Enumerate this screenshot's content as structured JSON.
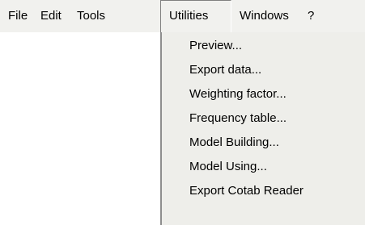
{
  "menubar": {
    "items": [
      {
        "label": "File"
      },
      {
        "label": "Edit"
      },
      {
        "label": "Tools"
      },
      {
        "label": "Utilities"
      },
      {
        "label": "Windows"
      },
      {
        "label": "?"
      }
    ]
  },
  "utilities_menu": {
    "items": [
      {
        "label": "Preview..."
      },
      {
        "label": "Export data..."
      },
      {
        "label": "Weighting factor..."
      },
      {
        "label": "Frequency table..."
      },
      {
        "label": "Model Building..."
      },
      {
        "label": "Model Using..."
      },
      {
        "label": "Export Cotab Reader"
      }
    ]
  }
}
